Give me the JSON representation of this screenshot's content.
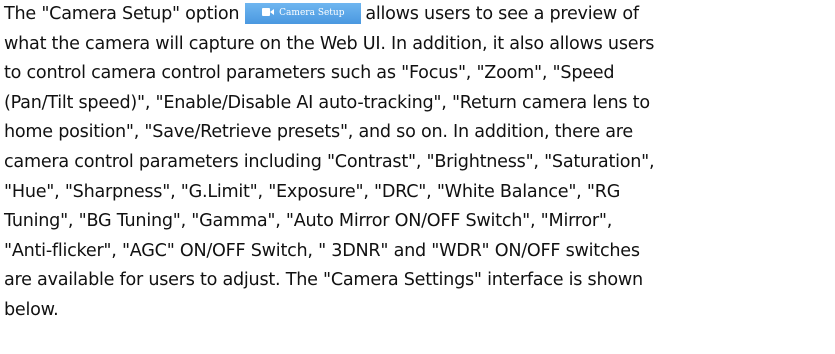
{
  "doc": {
    "line1_before": "The \"Camera Setup\" option",
    "button_label": "Camera Setup",
    "line1_after": "allows users to see a preview of",
    "lines": [
      "what the camera will capture on the Web UI. In addition, it also allows users",
      "to control camera control parameters such as \"Focus\", \"Zoom\", \"Speed",
      "(Pan/Tilt speed)\", \"Enable/Disable AI auto-tracking\", \"Return camera lens to",
      "home position\", \"Save/Retrieve presets\", and so on. In addition, there are",
      "camera control parameters including \"Contrast\", \"Brightness\", \"Saturation\",",
      "\"Hue\", \"Sharpness\", \"G.Limit\", \"Exposure\", \"DRC\", \"White Balance\", \"RG",
      "Tuning\", \"BG Tuning\", \"Gamma\", \"Auto Mirror ON/OFF Switch\", \"Mirror\",",
      "\"Anti-flicker\", \"AGC\" ON/OFF Switch, \" 3DNR\" and \"WDR\" ON/OFF switches",
      "are available for users to adjust. The \"Camera Settings\" interface is shown",
      "below."
    ]
  }
}
